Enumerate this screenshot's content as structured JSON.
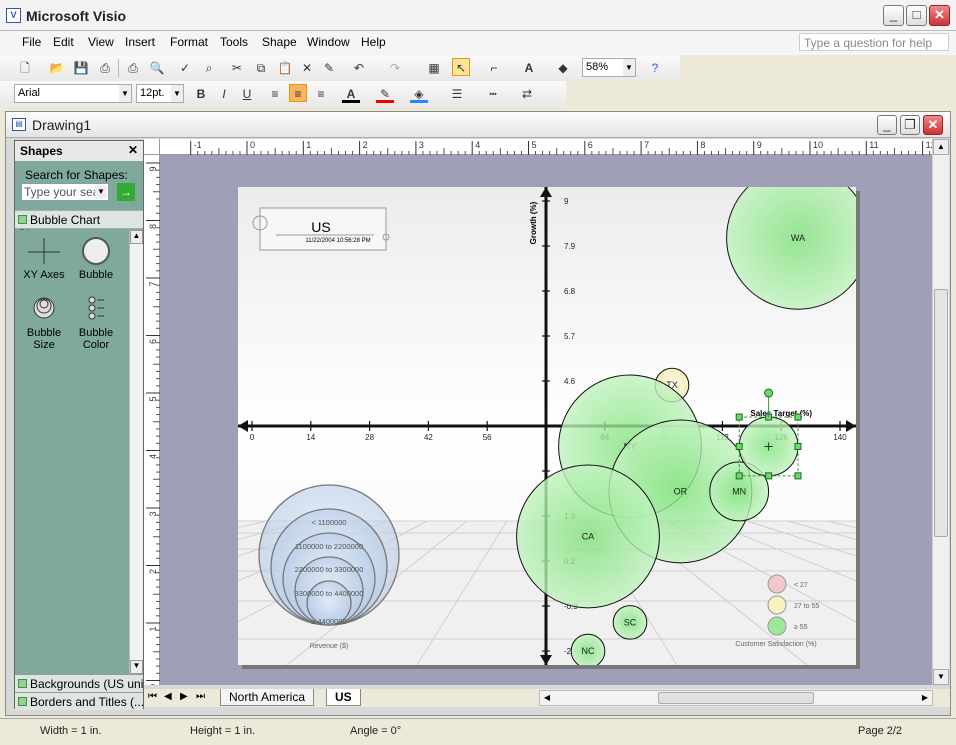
{
  "window": {
    "title": "Microsoft Visio"
  },
  "menu": {
    "items": [
      "File",
      "Edit",
      "View",
      "Insert",
      "Format",
      "Tools",
      "Shape",
      "Window",
      "Help"
    ],
    "help_placeholder": "Type a question for help"
  },
  "toolbar": {
    "zoom": "58%",
    "font": "Arial",
    "size": "12pt."
  },
  "doc": {
    "title": "Drawing1"
  },
  "shapes_pane": {
    "title": "Shapes",
    "search_label": "Search for Shapes:",
    "search_placeholder": "Type your sea",
    "stencil": "Bubble Chart Shapes",
    "masters": [
      "XY Axes",
      "Bubble",
      "Bubble Size",
      "Bubble Color"
    ],
    "bottom": [
      "Backgrounds (US units)",
      "Borders and Titles (..."
    ]
  },
  "ruler_h": [
    "-1",
    "0",
    "1",
    "2",
    "3",
    "4",
    "5",
    "6",
    "7",
    "8",
    "9",
    "10",
    "11",
    "12"
  ],
  "ruler_v": [
    "9",
    "8",
    "7",
    "6",
    "5",
    "4",
    "3",
    "2",
    "1",
    "0"
  ],
  "title_block": {
    "title": "US",
    "date": "11/22/2004 10:56:28 PM"
  },
  "colors": {
    "bubble_green": "#9ee89a",
    "bubble_yellow": "#f7f3bf",
    "legend_blue": "#bcd3ec",
    "legend_red": "#f1c9c9"
  },
  "chart_data": {
    "type": "scatter",
    "xlabel": "Sales Target (%)",
    "ylabel": "Growth (%)",
    "xlim": [
      0,
      140
    ],
    "ylim": [
      -2,
      9
    ],
    "x_ticks": [
      0,
      14,
      28,
      42,
      56,
      84,
      98,
      112,
      126,
      140
    ],
    "y_ticks": [
      "9",
      "7.9",
      "6.8",
      "5.7",
      "4.6",
      "2.4",
      "1.3",
      "0.2",
      "-0.9",
      "-2"
    ],
    "points": [
      {
        "label": "WA",
        "x": 130,
        "y": 8.1,
        "r": 1.7,
        "color": "green"
      },
      {
        "label": "TX",
        "x": 100,
        "y": 4.5,
        "r": 0.4,
        "color": "yellow"
      },
      {
        "label": "NY",
        "x": 90,
        "y": 3.0,
        "r": 1.7,
        "color": "green"
      },
      {
        "label": "OR",
        "x": 102,
        "y": 1.9,
        "r": 1.7,
        "color": "green"
      },
      {
        "label": "MN",
        "x": 116,
        "y": 1.9,
        "r": 0.7,
        "color": "green"
      },
      {
        "label": "CA",
        "x": 80,
        "y": 0.8,
        "r": 1.7,
        "color": "green"
      },
      {
        "label": "SC",
        "x": 90,
        "y": -1.3,
        "r": 0.4,
        "color": "green"
      },
      {
        "label": "NC",
        "x": 80,
        "y": -2.0,
        "r": 0.4,
        "color": "green"
      },
      {
        "label": "",
        "x": 123,
        "y": 3.0,
        "r": 0.7,
        "color": "green"
      }
    ]
  },
  "revenue_legend": {
    "items": [
      "< 1100000",
      "1100000 to 2200000",
      "2200000 to 3300000",
      "3300000 to 4400000",
      "≥ 4400000"
    ],
    "title": "Revenue ($)"
  },
  "satisfaction_legend": {
    "items": [
      "< 27",
      "27 to 55",
      "≥ 55"
    ],
    "title": "Customer Satisfaction (%)"
  },
  "tabs": [
    "North America",
    "US"
  ],
  "status": {
    "width": "Width = 1 in.",
    "height": "Height = 1 in.",
    "angle": "Angle = 0°",
    "page": "Page 2/2"
  }
}
